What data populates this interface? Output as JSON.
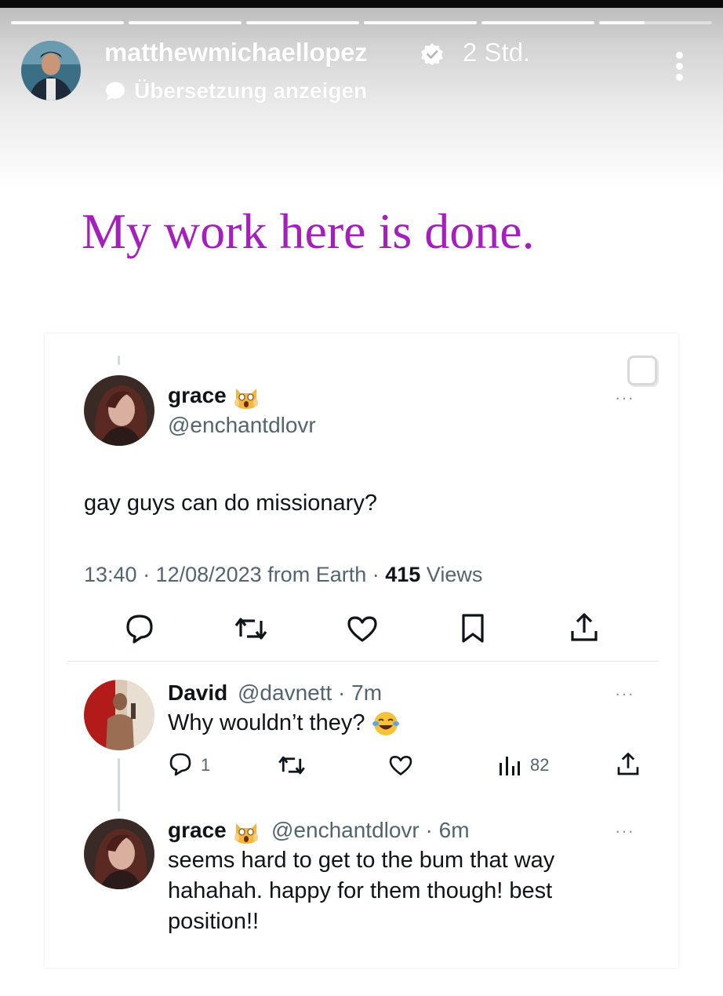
{
  "story": {
    "username": "matthewmichaellopez",
    "time": "2 Std.",
    "translate_label": "Übersetzung anzeigen",
    "progress_segments": 6,
    "caption": "My work here is done.",
    "caption_color": "#a51fbc"
  },
  "tweet": {
    "name": "grace",
    "handle": "@enchantdlovr",
    "text": "gay guys can do missionary?",
    "meta_prefix": "13:40 · 12/08/2023 from Earth · ",
    "views_count": "415",
    "views_label": " Views",
    "more": "···"
  },
  "reply1": {
    "name": "David",
    "handle": "@davnett · 7m",
    "text": "Why wouldn’t they?",
    "reply_count": "1",
    "views_count": "82",
    "more": "···"
  },
  "reply2": {
    "name": "grace",
    "handle": "@enchantdlovr · 6m",
    "line1": "seems hard to get to the bum that way",
    "line2": "hahahah. happy for them though! best",
    "line3": "position!!",
    "more": "···"
  },
  "icons": {
    "emoji_scream_cat": "scream-cat",
    "emoji_laugh": "tears-of-joy",
    "verified": "verified-badge",
    "action_color": "#536471"
  }
}
